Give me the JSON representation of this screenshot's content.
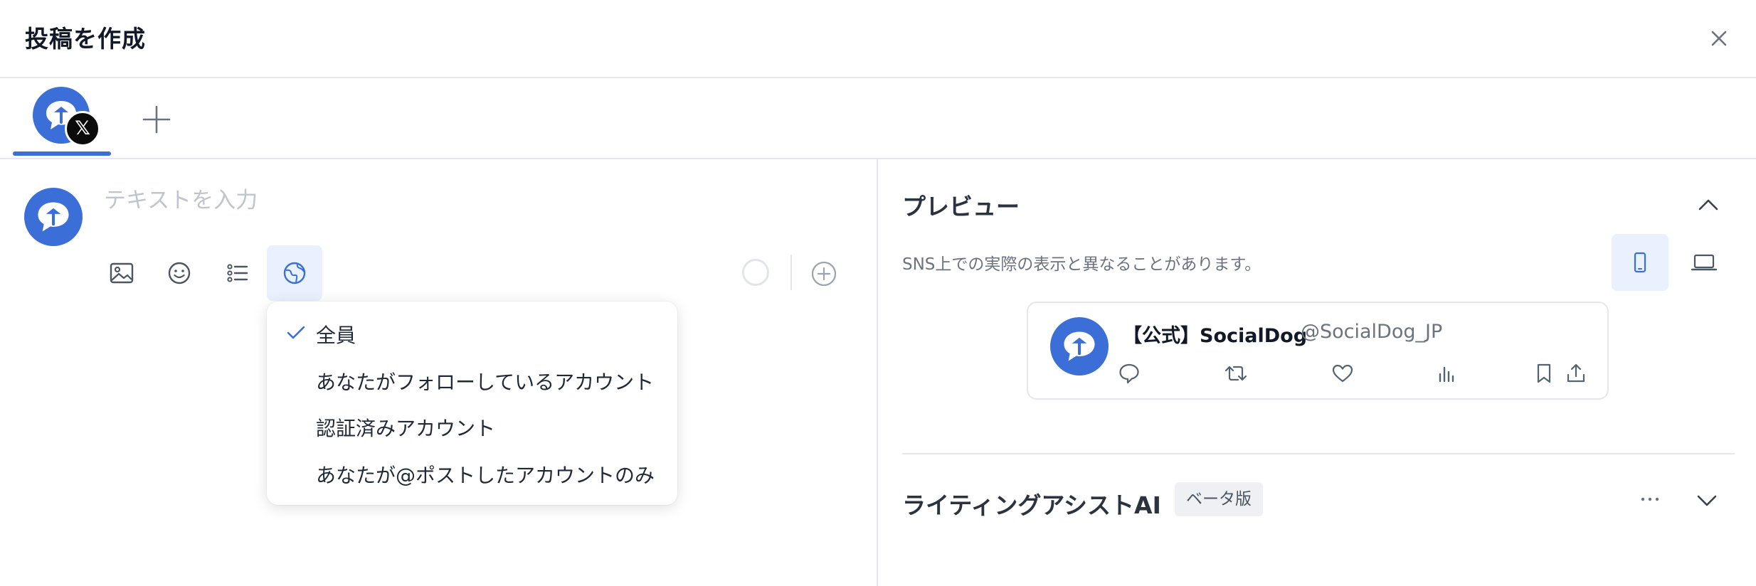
{
  "header": {
    "title": "投稿を作成"
  },
  "tabs": {
    "account_badge": "𝕏"
  },
  "composer": {
    "placeholder": "テキストを入力",
    "audience_menu": [
      {
        "label": "全員",
        "selected": true
      },
      {
        "label": "あなたがフォローしているアカウント",
        "selected": false
      },
      {
        "label": "認証済みアカウント",
        "selected": false
      },
      {
        "label": "あなたが@ポストしたアカウントのみ",
        "selected": false
      }
    ]
  },
  "preview": {
    "title": "プレビュー",
    "note": "SNS上での実際の表示と異なることがあります。",
    "post": {
      "name": "【公式】SocialDog",
      "handle": "@SocialDog_JP"
    }
  },
  "ai": {
    "title": "ライティングアシストAI",
    "badge": "ベータ版"
  },
  "colors": {
    "accent": "#3b6fd8",
    "accent_bg": "#e8f1fd",
    "border": "#e5e7eb"
  }
}
